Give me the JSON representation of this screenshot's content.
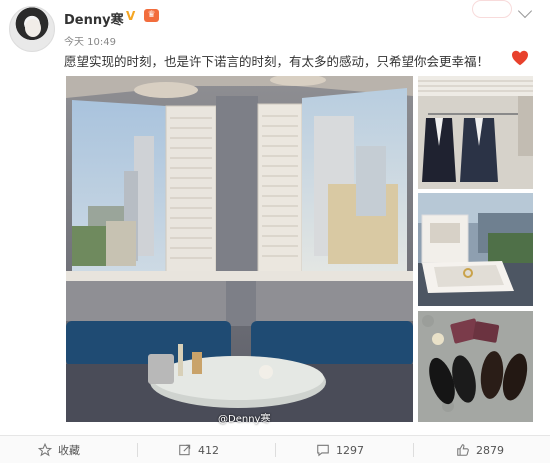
{
  "post": {
    "username": "Denny寒",
    "verified_badge": "V",
    "time": "今天 10:49",
    "text": "愿望实现的时刻，也是许下诺言的时刻，有太多的感动，只希望你会更幸福！",
    "photo_credit": "@Denny寒"
  },
  "icons": {
    "verified": "verified-v-icon",
    "member": "member-badge-icon",
    "menu": "chevron-down-icon",
    "emoji": "red-heart-icon",
    "favorite": "star-icon",
    "repost": "repost-icon",
    "comment": "comment-icon",
    "like": "thumbs-up-icon"
  },
  "actions": {
    "favorite_label": "收藏",
    "repost_count": "412",
    "comment_count": "1297",
    "like_count": "2879"
  },
  "colors": {
    "accent_orange": "#f5a623",
    "heart_red": "#e8412c",
    "text": "#333333",
    "muted": "#888888"
  }
}
